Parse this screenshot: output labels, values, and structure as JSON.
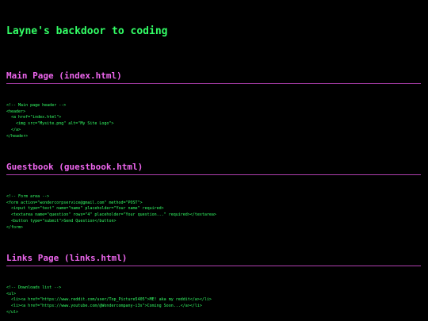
{
  "page": {
    "title": "Layne's backdoor to coding"
  },
  "sections": [
    {
      "heading": "Main Page (index.html)",
      "code": "<!-- Main page header -->\n<header>\n  <a href=\"index.html\">\n    <img src=\"Mysite.png\" alt=\"My Site Logo\">\n  </a>\n</header>"
    },
    {
      "heading": "Guestbook (guestbook.html)",
      "code": "<!-- Form area -->\n<form action=\"wondercorpservice@gmail.com\" method=\"POST\">\n  <input type=\"text\" name=\"name\" placeholder=\"Your name\" required>\n  <textarea name=\"question\" rows=\"4\" placeholder=\"Your question...\" required></textarea>\n  <button type=\"submit\">Send Question</button>\n</form>"
    },
    {
      "heading": "Links Page (links.html)",
      "code": "<!-- Downloads list -->\n<ul>\n  <li><a href=\"https://www.reddit.com/user/Top_Picture5405\">ME! aka my reddit</a></li>\n  <li><a href=\"https://www.youtube.com/@Wondercompany-i3s\">Coming Soon...</a></li>\n</ul>"
    }
  ],
  "colors": {
    "background": "#000000",
    "text": "#33ff66",
    "heading": "#ee66ee",
    "rule": "#b040b0"
  }
}
